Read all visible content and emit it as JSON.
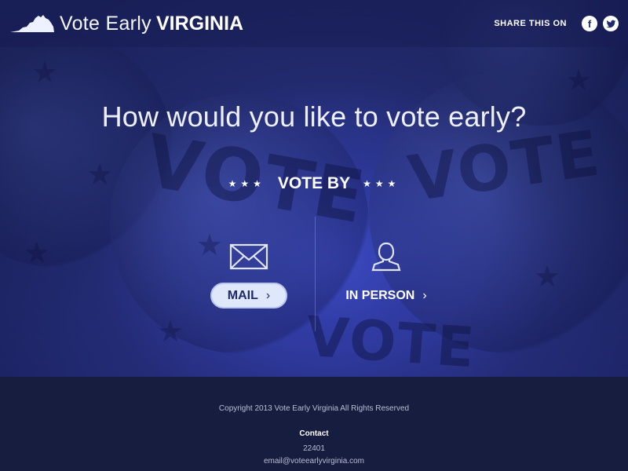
{
  "header": {
    "brand_light": "Vote Early",
    "brand_bold": "VIRGINIA",
    "share_label": "SHARE THIS ON",
    "facebook_glyph": "f",
    "twitter_glyph": "t"
  },
  "main": {
    "question": "How would you like to vote early?",
    "vote_by": "VOTE BY",
    "stars": "★★★",
    "options": [
      {
        "label": "MAIL",
        "icon": "envelope-icon"
      },
      {
        "label": "IN PERSON",
        "icon": "person-icon"
      }
    ],
    "chevron": "›"
  },
  "footer": {
    "copyright": "Copyright 2013 Vote Early Virginia All Rights Reserved",
    "contact_title": "Contact",
    "zip": "22401",
    "email": "email@voteearlyvirginia.com"
  },
  "colors": {
    "hero": "#27307a",
    "footer": "#171d3e",
    "mail_button": "#dfe7fb"
  }
}
